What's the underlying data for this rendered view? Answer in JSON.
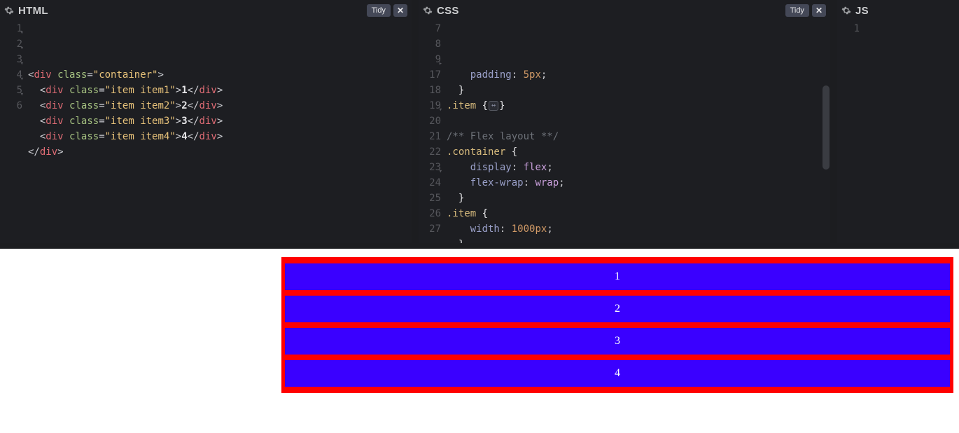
{
  "panels": {
    "html": {
      "title": "HTML",
      "tidy": "Tidy",
      "close": "✕",
      "lines": [
        {
          "n": "1",
          "fold": "▾",
          "html": "<span class='tok-punc'>&lt;</span><span class='tok-tag'>div</span> <span class='tok-attr'>class</span><span class='tok-punc'>=</span><span class='tok-str'>\"container\"</span><span class='tok-punc'>&gt;</span>"
        },
        {
          "n": "2",
          "fold": "▾",
          "html": "  <span class='tok-punc'>&lt;</span><span class='tok-tag'>div</span> <span class='tok-attr'>class</span><span class='tok-punc'>=</span><span class='tok-str'>\"item item1\"</span><span class='tok-punc'>&gt;</span><span class='tok-text'>1</span><span class='tok-punc'>&lt;/</span><span class='tok-tag'>div</span><span class='tok-punc'>&gt;</span>"
        },
        {
          "n": "3",
          "fold": "▾",
          "html": "  <span class='tok-punc'>&lt;</span><span class='tok-tag'>div</span> <span class='tok-attr'>class</span><span class='tok-punc'>=</span><span class='tok-str'>\"item item2\"</span><span class='tok-punc'>&gt;</span><span class='tok-text'>2</span><span class='tok-punc'>&lt;/</span><span class='tok-tag'>div</span><span class='tok-punc'>&gt;</span>"
        },
        {
          "n": "4",
          "fold": "▾",
          "html": "  <span class='tok-punc'>&lt;</span><span class='tok-tag'>div</span> <span class='tok-attr'>class</span><span class='tok-punc'>=</span><span class='tok-str'>\"item item3\"</span><span class='tok-punc'>&gt;</span><span class='tok-text'>3</span><span class='tok-punc'>&lt;/</span><span class='tok-tag'>div</span><span class='tok-punc'>&gt;</span>"
        },
        {
          "n": "5",
          "fold": "▾",
          "html": "  <span class='tok-punc'>&lt;</span><span class='tok-tag'>div</span> <span class='tok-attr'>class</span><span class='tok-punc'>=</span><span class='tok-str'>\"item item4\"</span><span class='tok-punc'>&gt;</span><span class='tok-text'>4</span><span class='tok-punc'>&lt;/</span><span class='tok-tag'>div</span><span class='tok-punc'>&gt;</span>"
        },
        {
          "n": "6",
          "fold": "",
          "html": "<span class='tok-punc'>&lt;/</span><span class='tok-tag'>div</span><span class='tok-punc'>&gt;</span>"
        }
      ]
    },
    "css": {
      "title": "CSS",
      "tidy": "Tidy",
      "close": "✕",
      "lines": [
        {
          "n": "7",
          "fold": "",
          "html": "    <span class='tok-prop'>padding</span><span class='tok-punc'>:</span> <span class='tok-val'>5px</span><span class='tok-punc'>;</span>"
        },
        {
          "n": "8",
          "fold": "",
          "html": "  <span class='tok-brace'>}</span>"
        },
        {
          "n": "9",
          "fold": "▸",
          "html": "<span class='tok-sel'>.item</span> <span class='tok-brace'>{</span><span class='fold-marker'>↔</span><span class='tok-brace'>}</span>"
        },
        {
          "n": "17",
          "fold": "",
          "html": ""
        },
        {
          "n": "18",
          "fold": "",
          "html": "<span class='tok-com'>/** Flex layout **/</span>"
        },
        {
          "n": "19",
          "fold": "▾",
          "html": "<span class='tok-sel'>.container</span> <span class='tok-brace'>{</span>"
        },
        {
          "n": "20",
          "fold": "",
          "html": "    <span class='tok-prop'>display</span><span class='tok-punc'>:</span> <span class='tok-kw'>flex</span><span class='tok-punc'>;</span>"
        },
        {
          "n": "21",
          "fold": "",
          "html": "    <span class='tok-prop'>flex-wrap</span><span class='tok-punc'>:</span> <span class='tok-kw'>wrap</span><span class='tok-punc'>;</span>"
        },
        {
          "n": "22",
          "fold": "",
          "html": "  <span class='tok-brace'>}</span>"
        },
        {
          "n": "23",
          "fold": "▾",
          "html": "<span class='tok-sel'>.item</span> <span class='tok-brace'>{</span>"
        },
        {
          "n": "24",
          "fold": "",
          "html": "    <span class='tok-prop'>width</span><span class='tok-punc'>:</span> <span class='tok-val'>1000px</span><span class='tok-punc'>;</span>"
        },
        {
          "n": "25",
          "fold": "",
          "html": "  <span class='tok-brace'>}</span>"
        },
        {
          "n": "26",
          "fold": "",
          "html": "<span class='cursor'></span>"
        },
        {
          "n": "27",
          "fold": "",
          "html": ""
        }
      ]
    },
    "js": {
      "title": "JS",
      "lines": [
        {
          "n": "1",
          "html": ""
        }
      ]
    }
  },
  "output": {
    "items": [
      "1",
      "2",
      "3",
      "4"
    ]
  }
}
